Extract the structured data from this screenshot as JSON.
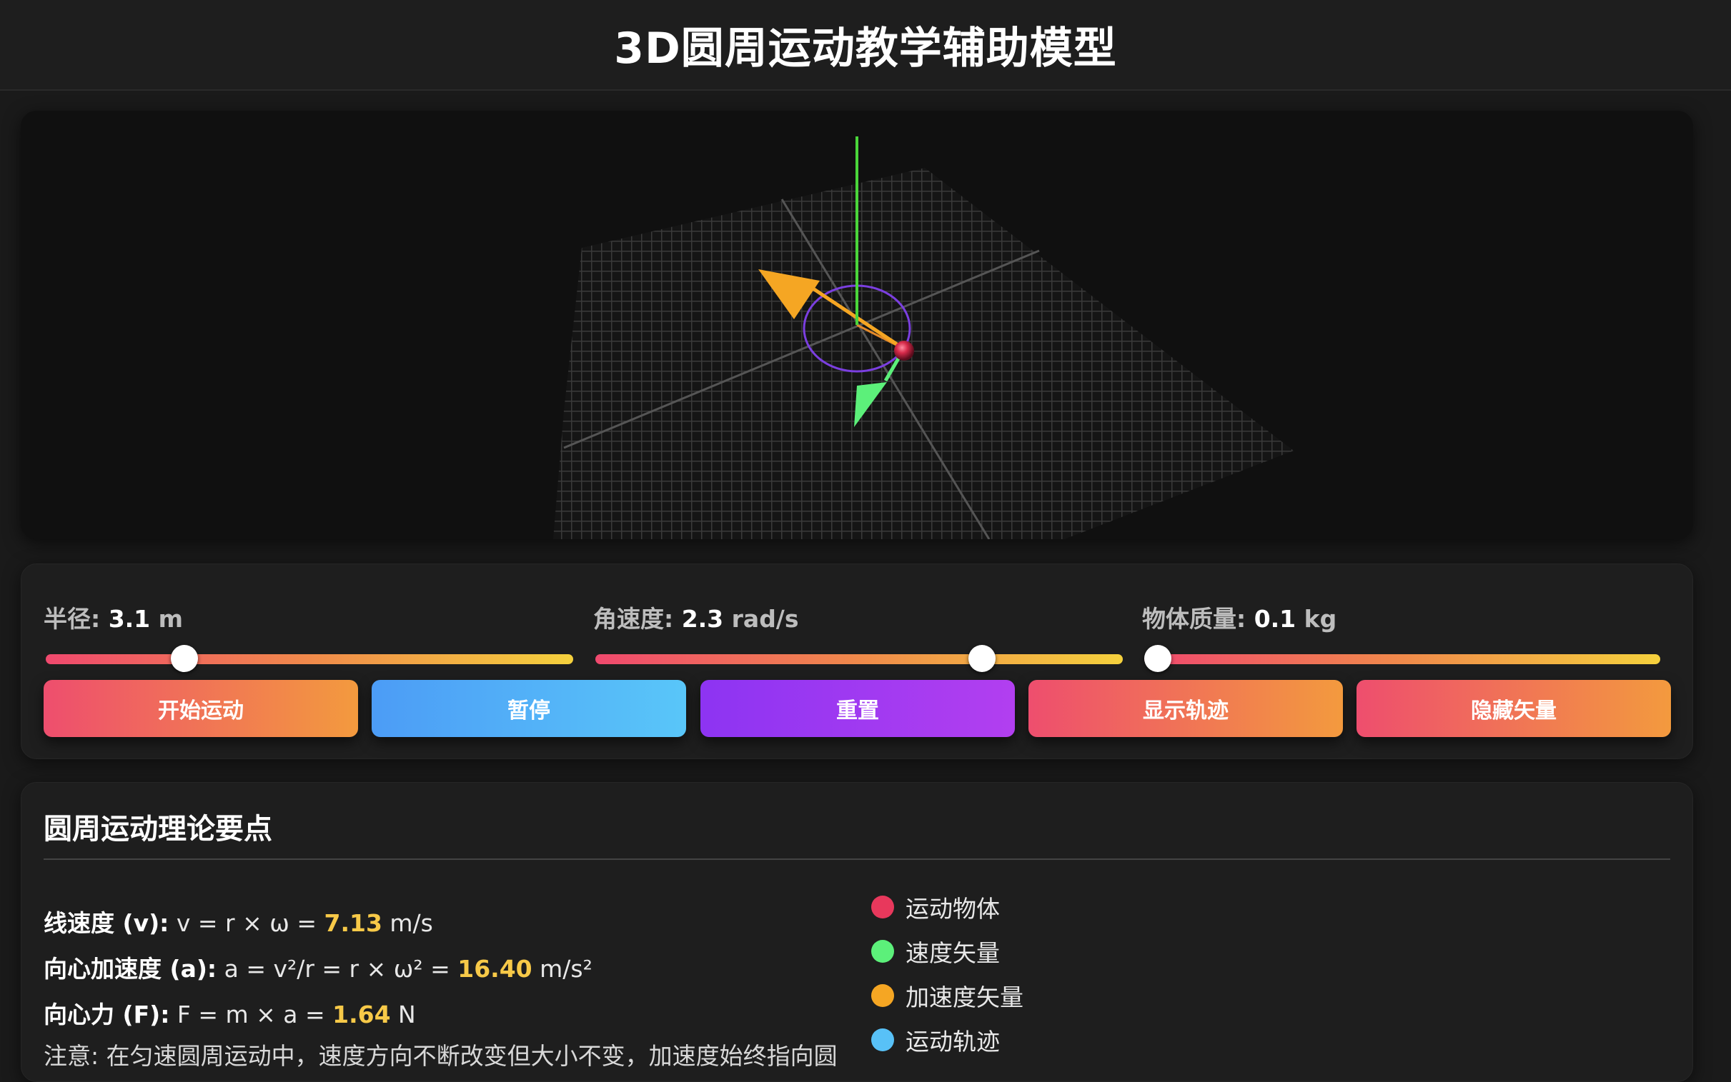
{
  "header": {
    "title": "3D圆周运动教学辅助模型"
  },
  "colors": {
    "object": "#e8385c",
    "velocity": "#5cf07a",
    "acceleration": "#f5a623",
    "trajectory": "#58c1f7",
    "y_axis": "#4ad63a",
    "orbit": "#7b3fe0"
  },
  "controls": {
    "radius": {
      "label": "半径: ",
      "value": "3.1",
      "unit": " m",
      "fraction": 0.25
    },
    "omega": {
      "label": "角速度: ",
      "value": "2.3",
      "unit": " rad/s",
      "fraction": 0.745
    },
    "mass": {
      "label": "物体质量: ",
      "value": "0.1",
      "unit": " kg",
      "fraction": 0.0
    },
    "buttons": {
      "start": "开始运动",
      "pause": "暂停",
      "reset": "重置",
      "trail": "显示轨迹",
      "vectors": "隐藏矢量"
    }
  },
  "theory": {
    "title": "圆周运动理论要点",
    "velocity": {
      "label": "线速度 (v):",
      "formula": " v = r × ω = ",
      "value": "7.13",
      "unit": " m/s"
    },
    "acceleration": {
      "label": "向心加速度 (a):",
      "formula": " a = v²/r = r × ω² = ",
      "value": "16.40",
      "unit": " m/s²"
    },
    "force": {
      "label": "向心力 (F):",
      "formula": " F = m × a = ",
      "value": "1.64",
      "unit": " N"
    },
    "note": "注意: 在匀速圆周运动中，速度方向不断改变但大小不变，加速度始终指向圆"
  },
  "legend": {
    "object": "运动物体",
    "velocity": "速度矢量",
    "acceleration": "加速度矢量",
    "trajectory": "运动轨迹"
  }
}
